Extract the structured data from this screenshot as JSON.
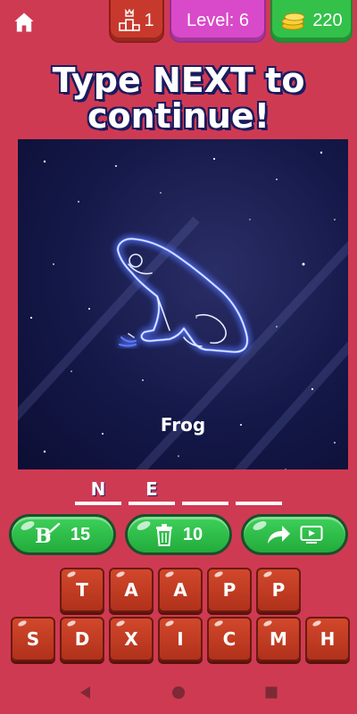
{
  "topbar": {
    "home_icon": "home-icon",
    "rank_icon": "podium-crown-icon",
    "rank_value": "1",
    "level_label": "Level: 6",
    "coins_icon": "coin-stack-icon",
    "coins_value": "220",
    "colors": {
      "rank": "#c8392d",
      "level": "#d84ac9",
      "coins": "#33c14a"
    }
  },
  "headline": {
    "line1": "Type NEXT to",
    "line2": "continue!"
  },
  "puzzle": {
    "caption": "Frog",
    "illustration": "frog-constellation"
  },
  "answer": {
    "slots": [
      "N",
      "E",
      "",
      ""
    ]
  },
  "helpers": {
    "reveal_letter": {
      "icon": "brush-letter-icon",
      "cost": "15"
    },
    "remove_letters": {
      "icon": "trash-icon",
      "cost": "10"
    },
    "share": {
      "icons": [
        "share-arrow-icon",
        "video-icon"
      ]
    }
  },
  "keyboard": {
    "row1": [
      "T",
      "A",
      "A",
      "P",
      "P"
    ],
    "row2": [
      "S",
      "D",
      "X",
      "I",
      "C",
      "M",
      "H"
    ]
  },
  "navbar": {
    "icons": [
      "back-icon",
      "home-circle-icon",
      "recents-icon"
    ]
  },
  "colors": {
    "background": "#cf3a53",
    "tile": "#c23e24",
    "helper": "#2fbf4a",
    "sky": "#141848",
    "glow": "#3a5cff"
  }
}
